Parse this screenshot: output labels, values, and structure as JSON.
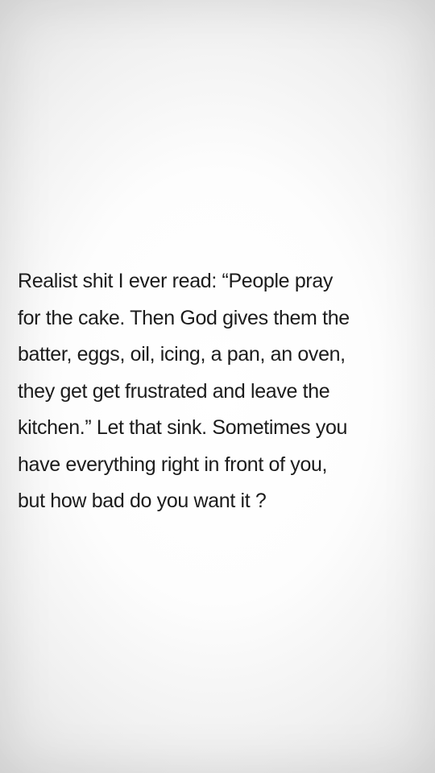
{
  "quote": {
    "lines": [
      "Realist shit I ever read: “People pray",
      "for the cake. Then God gives them the",
      "batter, eggs, oil, icing, a pan, an oven,",
      "they get get frustrated and leave the",
      "kitchen.” Let that sink. Sometimes you",
      "have everything right in front of you,",
      "but how bad do you want it ?"
    ]
  },
  "colors": {
    "text": "#1c1c1c",
    "background_center": "#ffffff",
    "background_edge": "#e4e4e4"
  }
}
